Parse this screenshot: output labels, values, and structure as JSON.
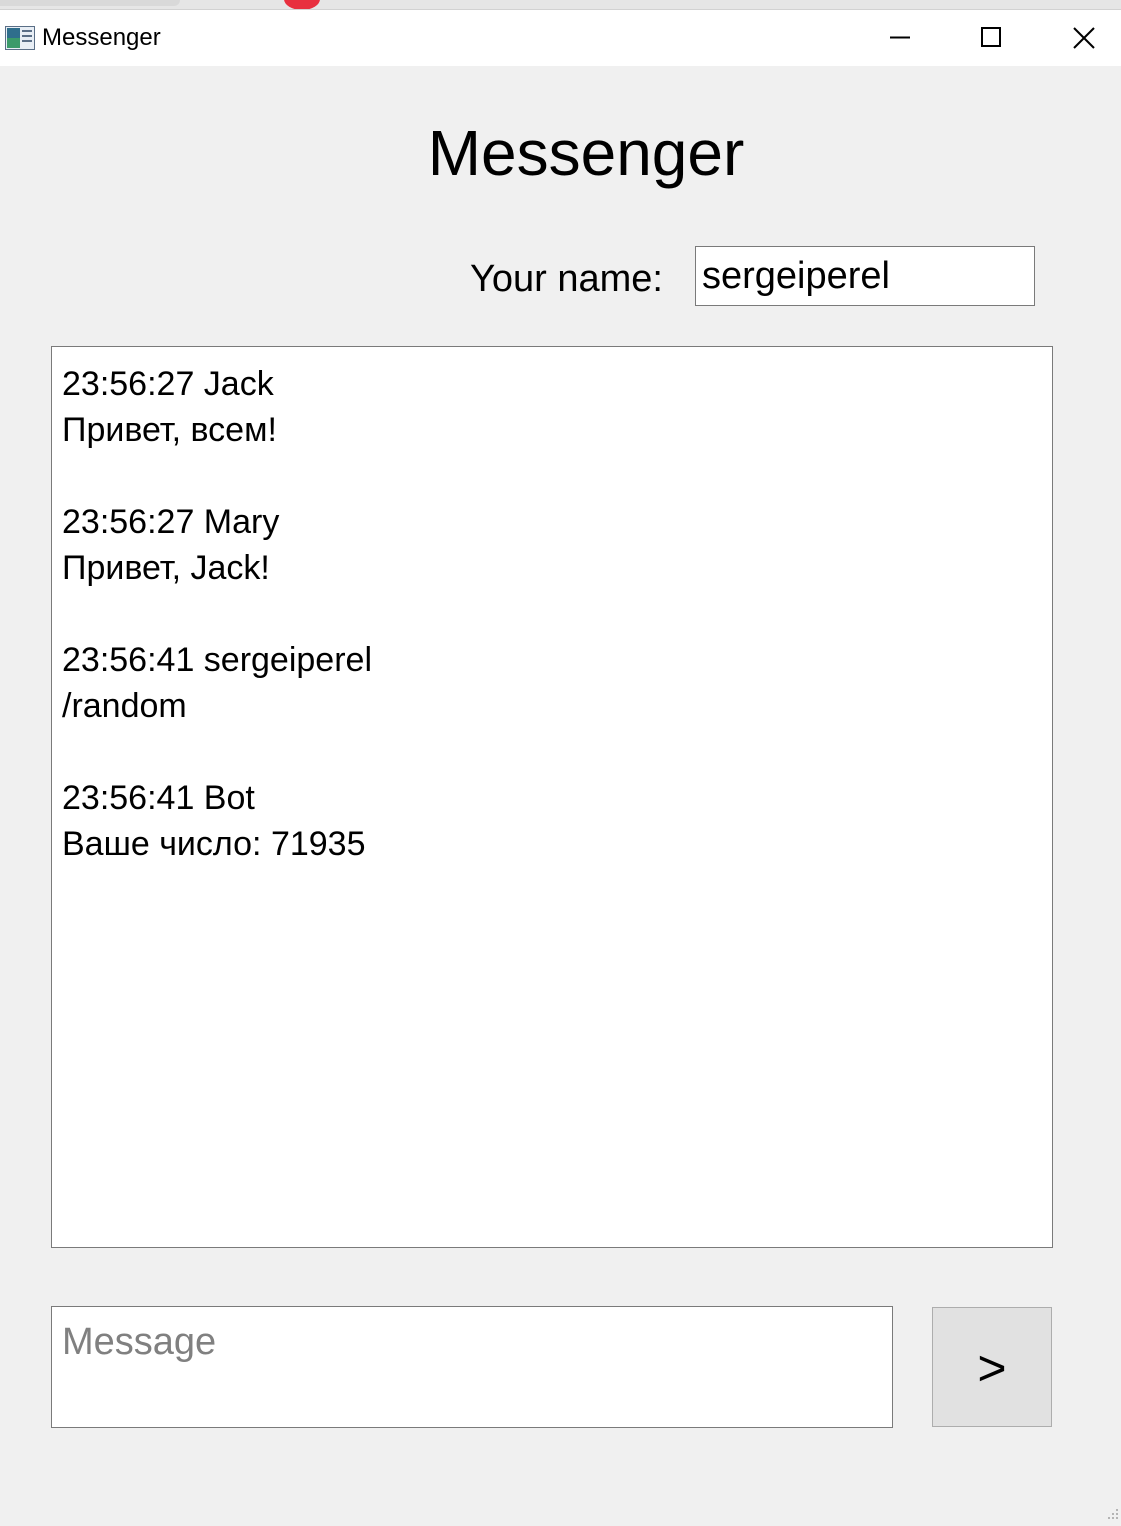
{
  "window": {
    "title": "Messenger",
    "controls": [
      "minimize-icon",
      "maximize-icon",
      "close-icon"
    ]
  },
  "header": {
    "title": "Messenger"
  },
  "name_field": {
    "label": "Your name:",
    "value": "sergeiperel"
  },
  "chat": {
    "messages": [
      {
        "header": "23:56:27 Jack",
        "text": "Привет, всем!"
      },
      {
        "header": "23:56:27 Mary",
        "text": "Привет, Jack!"
      },
      {
        "header": "23:56:41 sergeiperel",
        "text": "/random"
      },
      {
        "header": "23:56:41 Bot",
        "text": "Ваше число: 71935"
      }
    ]
  },
  "composer": {
    "placeholder": "Message",
    "value": "",
    "send_label": ">"
  },
  "colors": {
    "background": "#f0f0f0",
    "field_border": "#7a7a7a",
    "button_face": "#e1e1e1",
    "placeholder": "#808080"
  }
}
